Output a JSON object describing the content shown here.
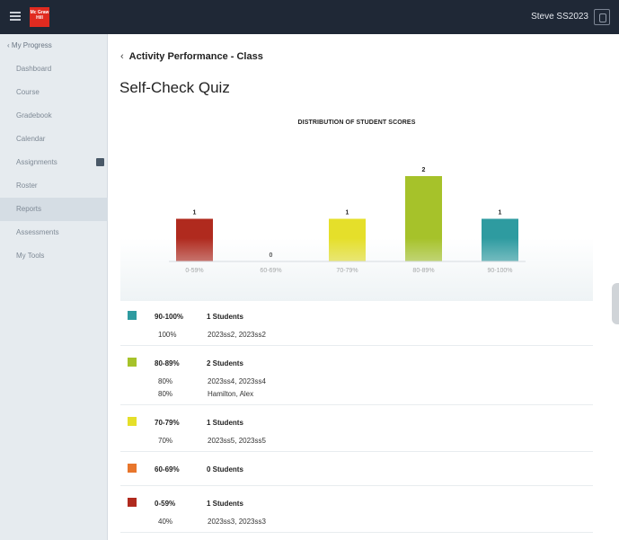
{
  "topbar": {
    "logo_text": "Mc Graw Hill",
    "user_name": "Steve SS2023"
  },
  "sidebar": {
    "back_label": "My Progress",
    "items": [
      {
        "label": "Dashboard"
      },
      {
        "label": "Course"
      },
      {
        "label": "Gradebook"
      },
      {
        "label": "Calendar"
      },
      {
        "label": "Assignments"
      },
      {
        "label": "Roster"
      },
      {
        "label": "Reports",
        "active": true
      },
      {
        "label": "Assessments"
      },
      {
        "label": "My Tools"
      }
    ]
  },
  "header": {
    "back_label": "Activity Performance - Class",
    "page_title": "Self-Check Quiz"
  },
  "chart_data": {
    "type": "bar",
    "title": "DISTRIBUTION OF STUDENT SCORES",
    "categories": [
      "0-59%",
      "60-69%",
      "70-79%",
      "80-89%",
      "90-100%"
    ],
    "values": [
      1,
      0,
      1,
      2,
      1
    ],
    "colors": [
      "#b02a1e",
      "#e8762c",
      "#e5df2a",
      "#a6c22a",
      "#2e9ba0"
    ],
    "ylim": [
      0,
      2
    ],
    "xlabel": "",
    "ylabel": ""
  },
  "legend": [
    {
      "range": "90-100%",
      "count": "1 Students",
      "color": "#2e9ba0",
      "rows": [
        {
          "pct": "100%",
          "names": "2023ss2, 2023ss2"
        }
      ]
    },
    {
      "range": "80-89%",
      "count": "2 Students",
      "color": "#a6c22a",
      "rows": [
        {
          "pct": "80%",
          "names": "2023ss4, 2023ss4"
        },
        {
          "pct": "80%",
          "names": "Hamilton, Alex"
        }
      ]
    },
    {
      "range": "70-79%",
      "count": "1 Students",
      "color": "#e5df2a",
      "rows": [
        {
          "pct": "70%",
          "names": "2023ss5, 2023ss5"
        }
      ]
    },
    {
      "range": "60-69%",
      "count": "0 Students",
      "color": "#e8762c",
      "rows": []
    },
    {
      "range": "0-59%",
      "count": "1 Students",
      "color": "#b02a1e",
      "rows": [
        {
          "pct": "40%",
          "names": "2023ss3, 2023ss3"
        }
      ]
    }
  ]
}
